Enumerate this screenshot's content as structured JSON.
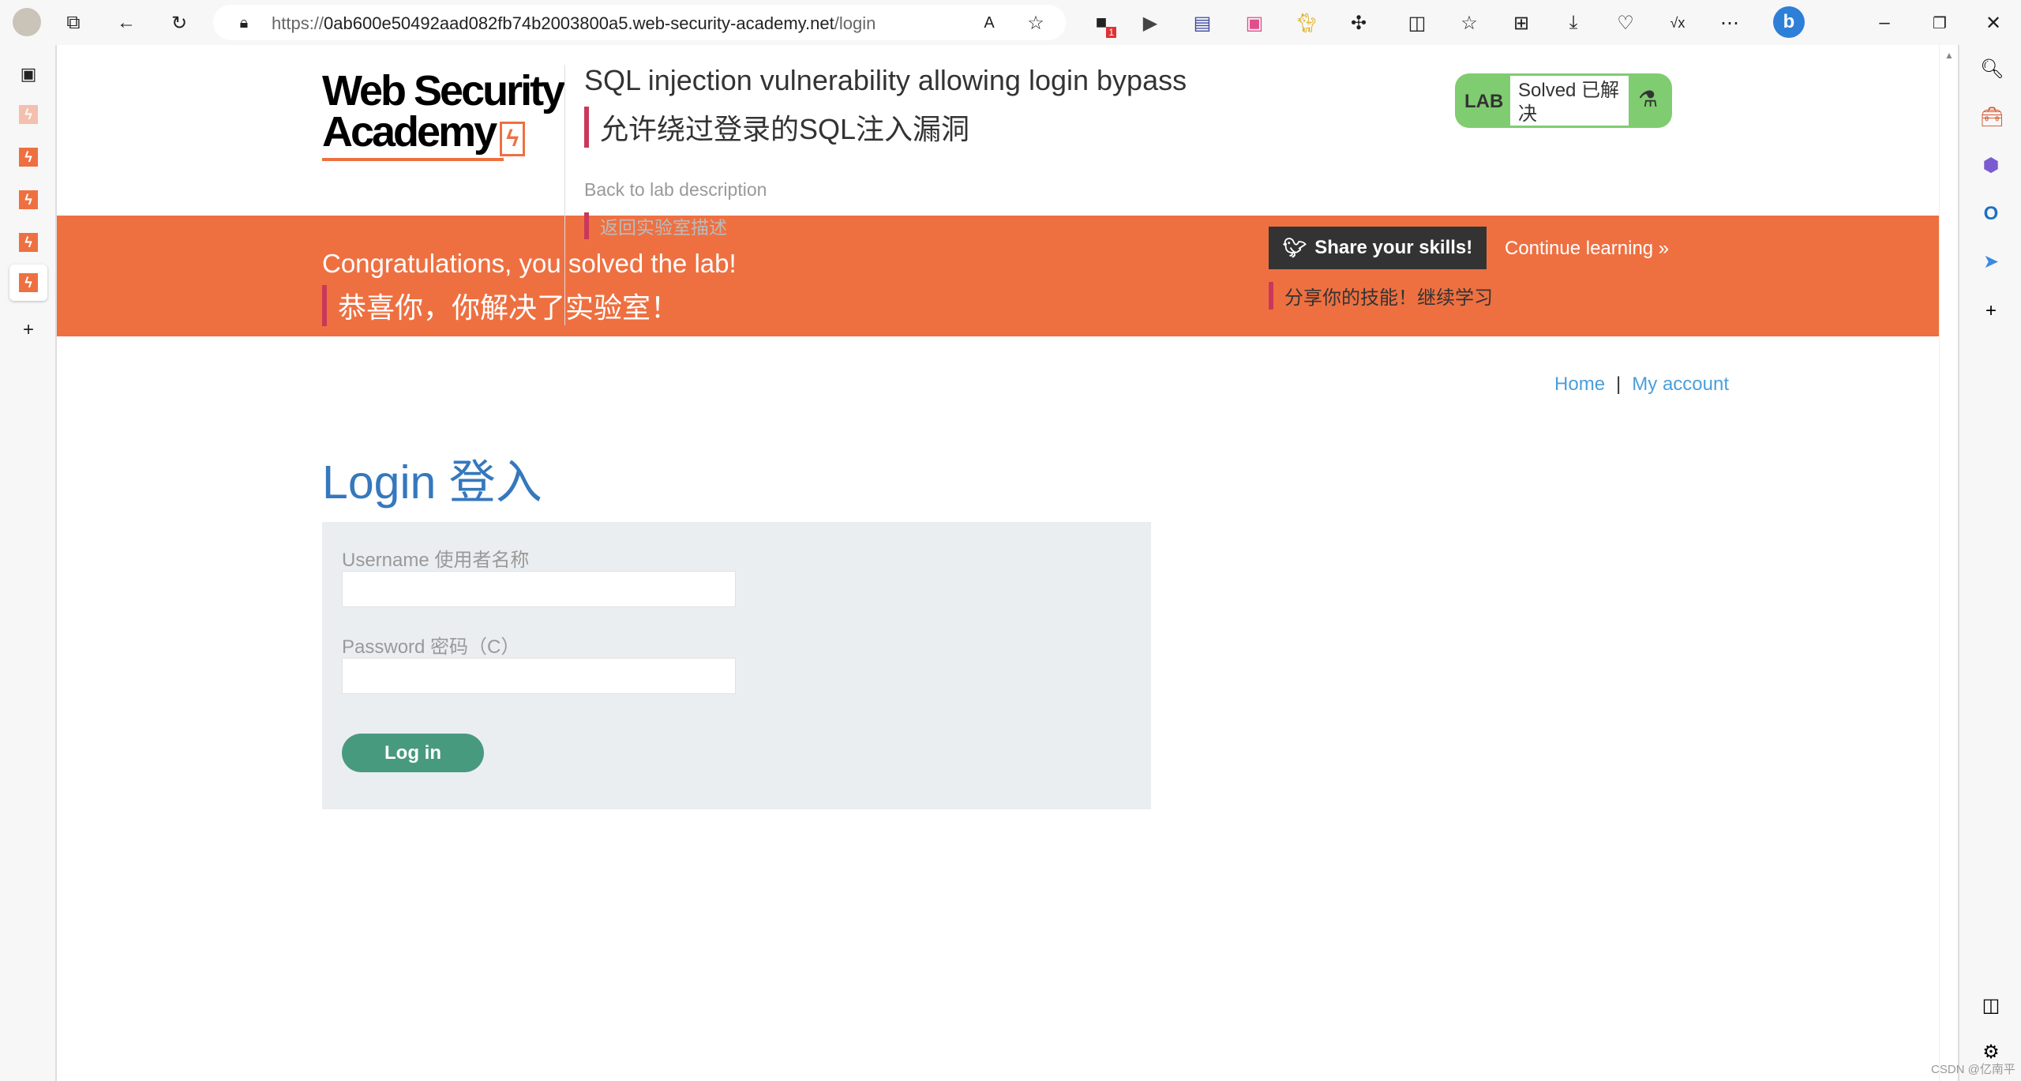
{
  "browser": {
    "url_prefix": "https://",
    "url_host": "0ab600e50492aad082fb74b2003800a5.web-security-academy.net",
    "url_path": "/login",
    "extension_badge": "1",
    "icons": [
      "profile-avatar",
      "tabs-icon",
      "back-icon",
      "refresh-icon",
      "lock-icon",
      "read-aloud-icon",
      "favorite-star-icon",
      "extension-icon",
      "play-icon",
      "reader-icon",
      "translate-icon",
      "cat-extension-icon",
      "extensions-puzzle-icon",
      "split-screen-icon",
      "favorites-icon",
      "collections-icon",
      "download-icon",
      "health-icon",
      "math-solver-icon",
      "more-icon",
      "bing-icon",
      "minimize-icon",
      "restore-icon",
      "close-icon"
    ]
  },
  "lab": {
    "logo_line1": "Web Security",
    "logo_line2": "Academy",
    "title": "SQL injection vulnerability allowing login bypass",
    "title_zh": "允许绕过登录的SQL注入漏洞",
    "back_link": "Back to lab description",
    "back_link_zh": "返回实验室描述",
    "badge_label": "LAB",
    "badge_status": "Solved 已解决",
    "badge_color": "#80cc70"
  },
  "banner": {
    "congrats": "Congratulations, you solved the lab!",
    "congrats_zh": "恭喜你，你解决了实验室！",
    "share": "Share your skills!",
    "continue": "Continue learning »",
    "share_zh": "分享你的技能！继续学习",
    "color": "#ee7041"
  },
  "nav": {
    "home": "Home",
    "separator": "|",
    "account": "My account"
  },
  "login": {
    "heading": "Login 登入",
    "username_label": "Username 使用者名称",
    "username_value": "",
    "password_label": "Password 密码（C）",
    "password_value": "",
    "submit": "Log in"
  },
  "watermark": "CSDN @亿南平"
}
